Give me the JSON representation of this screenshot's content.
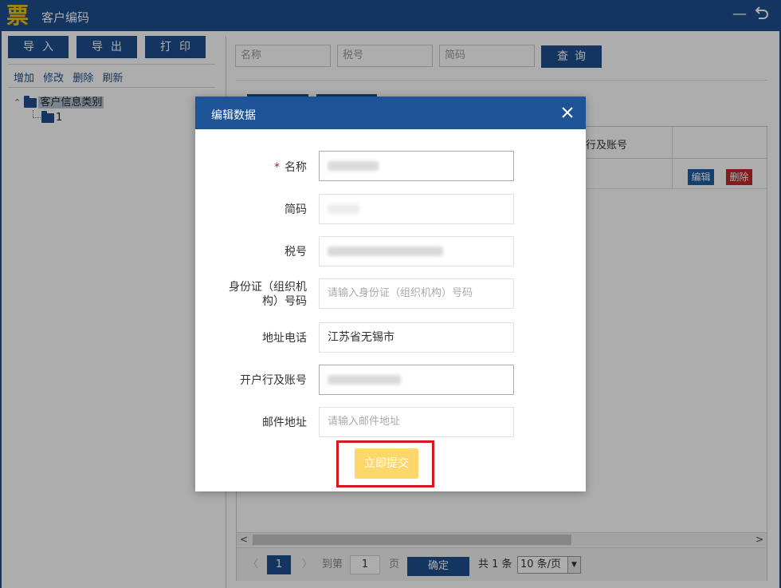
{
  "app": {
    "logo_char": "票",
    "title": "客户编码"
  },
  "toolbar": {
    "import": "导入",
    "export": "导出",
    "print": "打印"
  },
  "tree_actions": {
    "add": "增加",
    "edit": "修改",
    "delete": "删除",
    "refresh": "刷新"
  },
  "tree": {
    "root": "客户信息类别",
    "child": "1",
    "collapse_glyph": "⌃"
  },
  "search": {
    "name_ph": "名称",
    "tax_ph": "税号",
    "code_ph": "简码",
    "query": "查询"
  },
  "grid": {
    "header_partial": "行及账号",
    "edit_btn": "编辑",
    "delete_btn": "删除"
  },
  "pager": {
    "prev": "〈",
    "next": "〉",
    "current": "1",
    "goto_prefix": "到第",
    "goto_value": "1",
    "goto_suffix": "页",
    "confirm": "确定",
    "total": "共 1 条",
    "page_size": "10 条/页",
    "scroll_left": "<",
    "scroll_right": ">"
  },
  "modal": {
    "title": "编辑数据",
    "required_mark": "*",
    "fields": {
      "name_label": "名称",
      "code_label": "简码",
      "tax_label": "税号",
      "id_label_line1": "身份证（组织机",
      "id_label_line2": "构）号码",
      "id_placeholder": "请输入身份证（组织机构）号码",
      "address_label": "地址电话",
      "address_value": "江苏省无锡市",
      "bank_label": "开户行及账号",
      "email_label": "邮件地址",
      "email_placeholder": "请输入邮件地址"
    },
    "submit": "立即提交"
  },
  "colors": {
    "brand": "#1c4f8c",
    "accent_yellow": "#fdd76a",
    "danger": "#c0282b",
    "highlight_red": "#d8191c"
  },
  "icons": {
    "minimize": "minimize-icon",
    "back": "return-icon",
    "close": "close-icon",
    "folder": "folder-icon"
  }
}
